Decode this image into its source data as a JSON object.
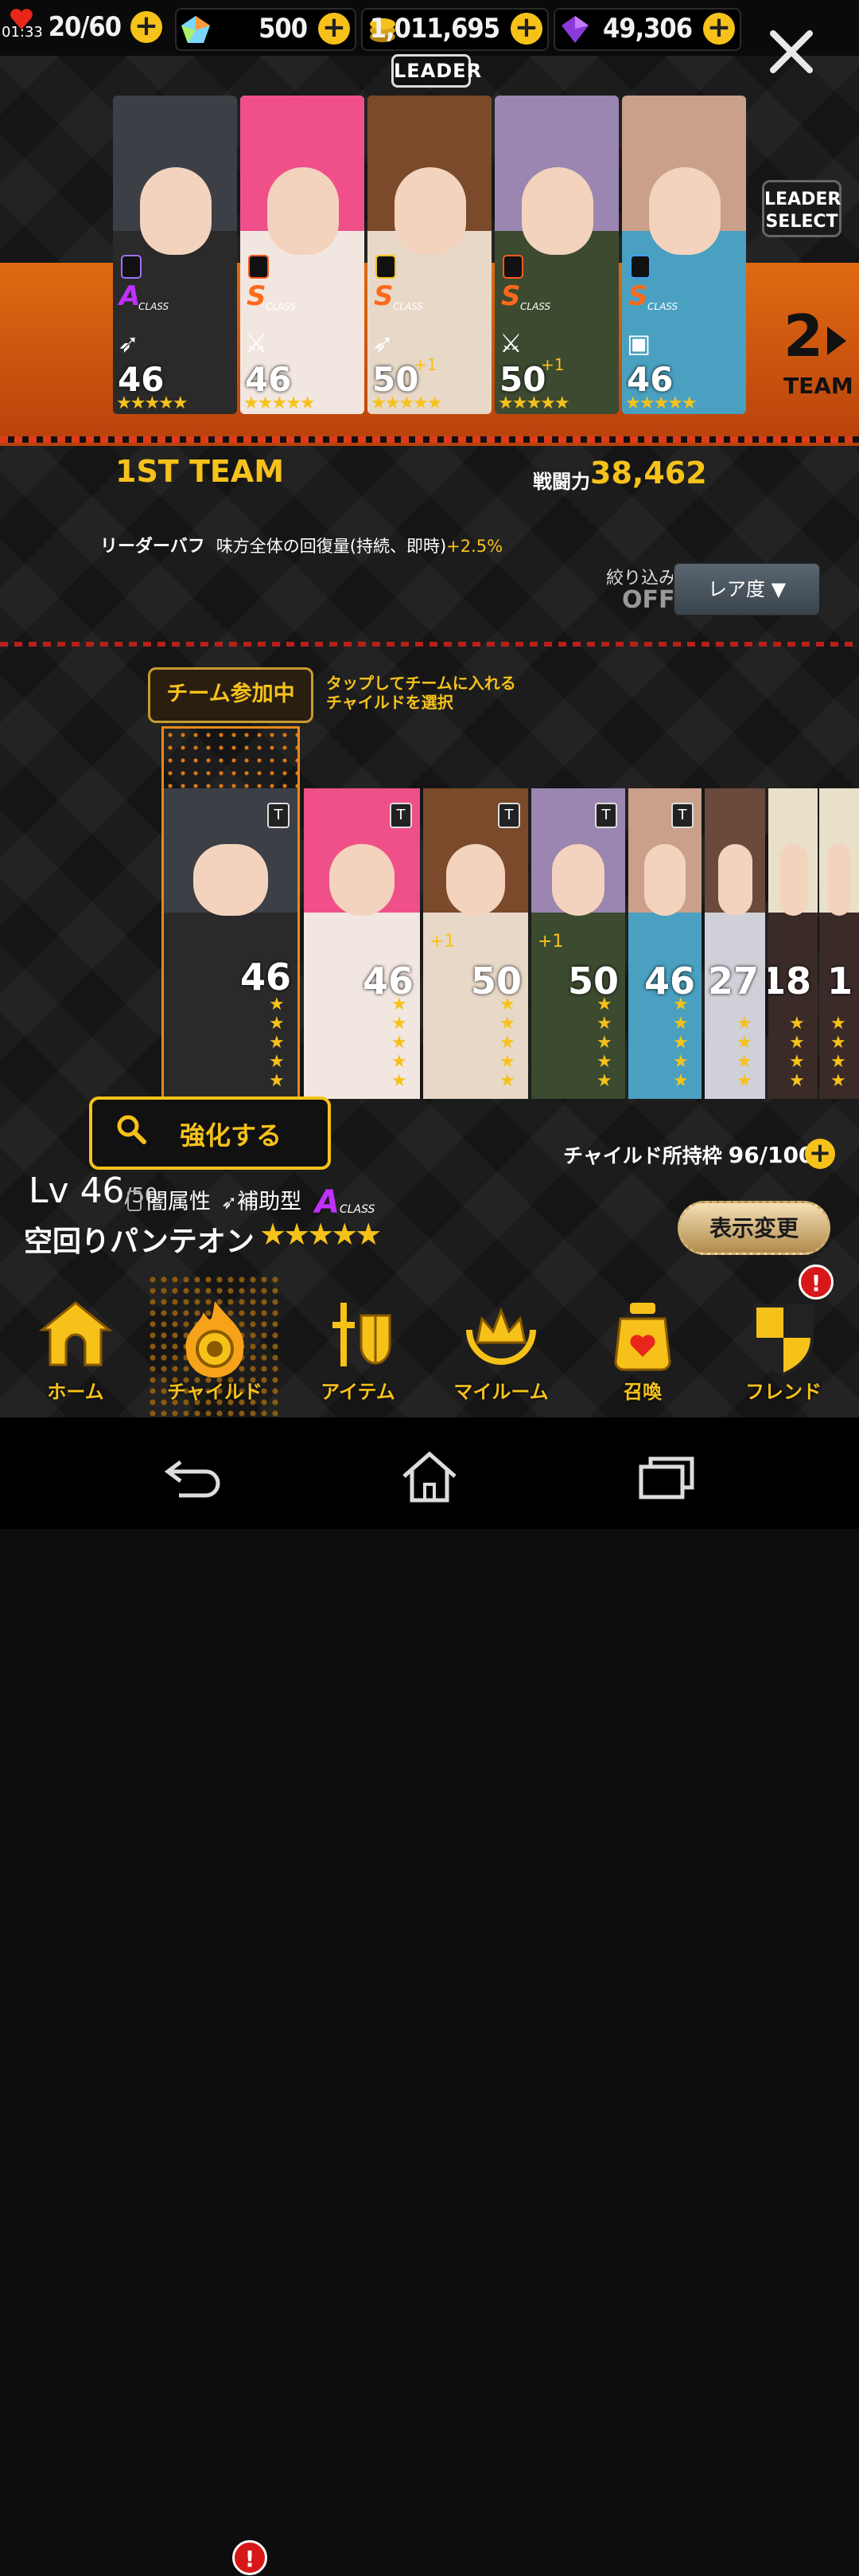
{
  "status": {
    "clock": "01:33",
    "stamina": "20/60",
    "gems": "500",
    "gold": "1,011,695",
    "crystals": "49,306"
  },
  "leader_label": "LEADER",
  "leader_select": {
    "line1": "LEADER",
    "line2": "SELECT"
  },
  "team_switch": {
    "number": "2",
    "label": "TEAM"
  },
  "team_cards": [
    {
      "level": "46",
      "class": "A",
      "class_label": "CLASS",
      "class_color": "#c030ff",
      "element": "dark",
      "role": "support",
      "plus": "",
      "hair": "#3c3f46",
      "body": "#2a2a2a",
      "stars": "★★★★★"
    },
    {
      "level": "46",
      "class": "S",
      "class_label": "CLASS",
      "class_color": "#ff6a1a",
      "element": "fire",
      "role": "attack",
      "plus": "",
      "hair": "#f0508a",
      "body": "#f2e6e0",
      "stars": "★★★★★"
    },
    {
      "level": "50",
      "class": "S",
      "class_label": "CLASS",
      "class_color": "#ff6a1a",
      "element": "light",
      "role": "support",
      "plus": "+1",
      "hair": "#7a4a2a",
      "body": "#e8d8c8",
      "stars": "★★★★★"
    },
    {
      "level": "50",
      "class": "S",
      "class_label": "CLASS",
      "class_color": "#ff6a1a",
      "element": "fire",
      "role": "attack",
      "plus": "+1",
      "hair": "#9a86b0",
      "body": "#3c4a30",
      "stars": "★★★★★"
    },
    {
      "level": "46",
      "class": "S",
      "class_label": "CLASS",
      "class_color": "#ff6a1a",
      "element": "water",
      "role": "balance",
      "plus": "",
      "hair": "#caa08a",
      "body": "#4aa0c0",
      "stars": "★★★★★"
    }
  ],
  "team_name": "1ST TEAM",
  "power": {
    "label": "戦闘力",
    "value": "38,462"
  },
  "leader_buff": {
    "label": "リーダーバフ",
    "text": "味方全体の回復量(持続、即時)",
    "value": "+2.5%"
  },
  "filter": {
    "label": "絞り込み",
    "state": "OFF",
    "sort": "レア度"
  },
  "joined_label": "チーム参加中",
  "tap_hint": [
    "タップしてチームに入れる",
    "チャイルドを選択"
  ],
  "child_cards": [
    {
      "level": "46",
      "stars": "★★★★★",
      "hair": "#3c3f46",
      "body": "#2a2a2a"
    },
    {
      "level": "46",
      "stars": "★★★★★",
      "hair": "#f0508a",
      "body": "#f2e6e0"
    },
    {
      "level": "50",
      "stars": "★★★★★",
      "plus": "+1",
      "hair": "#7a4a2a",
      "body": "#e8d8c8"
    },
    {
      "level": "50",
      "stars": "★★★★★",
      "plus": "+1",
      "hair": "#9a86b0",
      "body": "#3c4a30"
    },
    {
      "level": "46",
      "stars": "★★★★★",
      "hair": "#caa08a",
      "body": "#4aa0c0"
    },
    {
      "level": "27",
      "stars": "★★★★",
      "hair": "#6a4a3a",
      "body": "#d0d0d8"
    },
    {
      "level": "18",
      "stars": "★★★★",
      "hair": "#e8e0c8",
      "body": "#3a2a28"
    },
    {
      "level": "1",
      "stars": "★★★★",
      "hair": "#e8e0c8",
      "body": "#3a2a28"
    }
  ],
  "enhance_label": "強化する",
  "owned": {
    "label": "チャイルド所持枠",
    "count": "96/100"
  },
  "selected": {
    "lv_prefix": "Lv",
    "level": "46",
    "max": "/50",
    "attr": "闇属性",
    "type": "補助型",
    "class": "A",
    "class_label": "CLASS",
    "name": "空回りパンテオン",
    "stars": "★★★★★"
  },
  "view_change": "表示変更",
  "nav": [
    {
      "label": "ホーム",
      "icon": "home-icon"
    },
    {
      "label": "チャイルド",
      "icon": "child-icon",
      "badge": "!"
    },
    {
      "label": "アイテム",
      "icon": "item-icon"
    },
    {
      "label": "マイルーム",
      "icon": "myroom-icon"
    },
    {
      "label": "召喚",
      "icon": "summon-icon"
    },
    {
      "label": "フレンド",
      "icon": "friend-icon",
      "badge": "!"
    }
  ],
  "colors": {
    "accent": "#f6c21a",
    "band": "#d85e12",
    "alert": "#d81818"
  }
}
